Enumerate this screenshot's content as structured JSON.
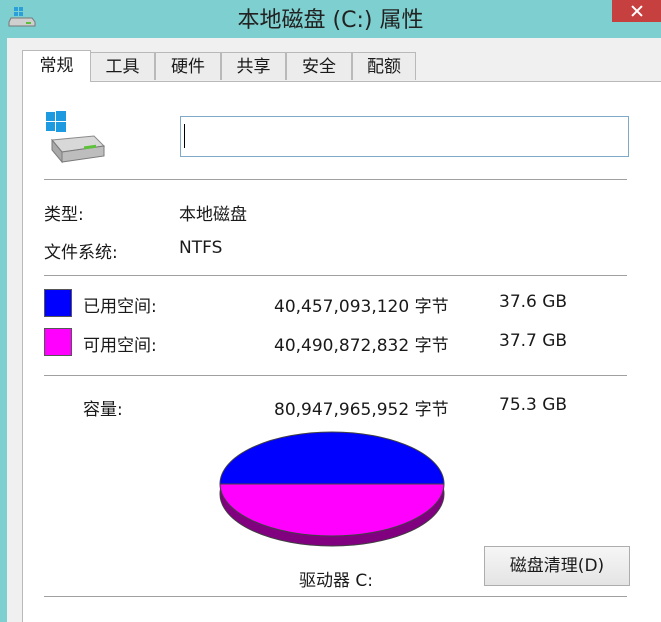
{
  "window": {
    "title": "本地磁盘 (C:) 属性"
  },
  "tabs": [
    {
      "label": "常规",
      "active": true
    },
    {
      "label": "工具",
      "active": false
    },
    {
      "label": "硬件",
      "active": false
    },
    {
      "label": "共享",
      "active": false
    },
    {
      "label": "安全",
      "active": false
    },
    {
      "label": "配额",
      "active": false
    }
  ],
  "general": {
    "name_value": "",
    "type_label": "类型:",
    "type_value": "本地磁盘",
    "fs_label": "文件系统:",
    "fs_value": "NTFS",
    "used": {
      "label": "已用空间:",
      "bytes": "40,457,093,120 字节",
      "size": "37.6 GB",
      "color": "#0000ff"
    },
    "free": {
      "label": "可用空间:",
      "bytes": "40,490,872,832 字节",
      "size": "37.7 GB",
      "color": "#ff00ff"
    },
    "capacity": {
      "label": "容量:",
      "bytes": "80,947,965,952 字节",
      "size": "75.3 GB"
    },
    "pie": {
      "used_fraction": 0.4998,
      "free_fraction": 0.5002
    },
    "drive_label": "驱动器 C:",
    "cleanup_button": "磁盘清理(D)"
  }
}
